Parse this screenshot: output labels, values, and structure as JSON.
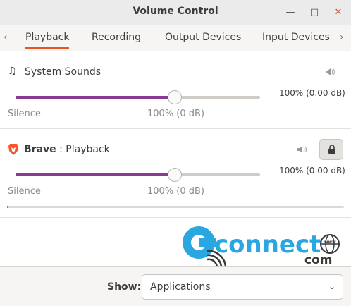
{
  "window": {
    "title": "Volume Control"
  },
  "tabs": [
    {
      "label": "Playback",
      "active": true
    },
    {
      "label": "Recording",
      "active": false
    },
    {
      "label": "Output Devices",
      "active": false
    },
    {
      "label": "Input Devices",
      "active": false
    }
  ],
  "streams": [
    {
      "name": "System Sounds",
      "app_bold": "",
      "volume_text": "100% (0.00 dB)",
      "volume_fraction": 0.65,
      "mark_silence": "Silence",
      "mark_100": "100% (0 dB)",
      "icon": "music-note-icon"
    },
    {
      "name": "Playback",
      "app_bold": "Brave",
      "separator": " : ",
      "volume_text": "100% (0.00 dB)",
      "volume_fraction": 0.65,
      "mark_silence": "Silence",
      "mark_100": "100% (0 dB)",
      "icon": "brave-logo-icon",
      "peak_level_fraction": 0.005
    }
  ],
  "watermark": {
    "text": "connect",
    "suffix": "com",
    "www": "www"
  },
  "footer": {
    "show_label": "Show:",
    "show_value": "Applications"
  },
  "colors": {
    "accent": "#e95420",
    "slider_fill": "#8b3a94",
    "brave": "#fb542b",
    "logo_blue": "#2aa7e0",
    "logo_dark": "#3a3a3a"
  }
}
